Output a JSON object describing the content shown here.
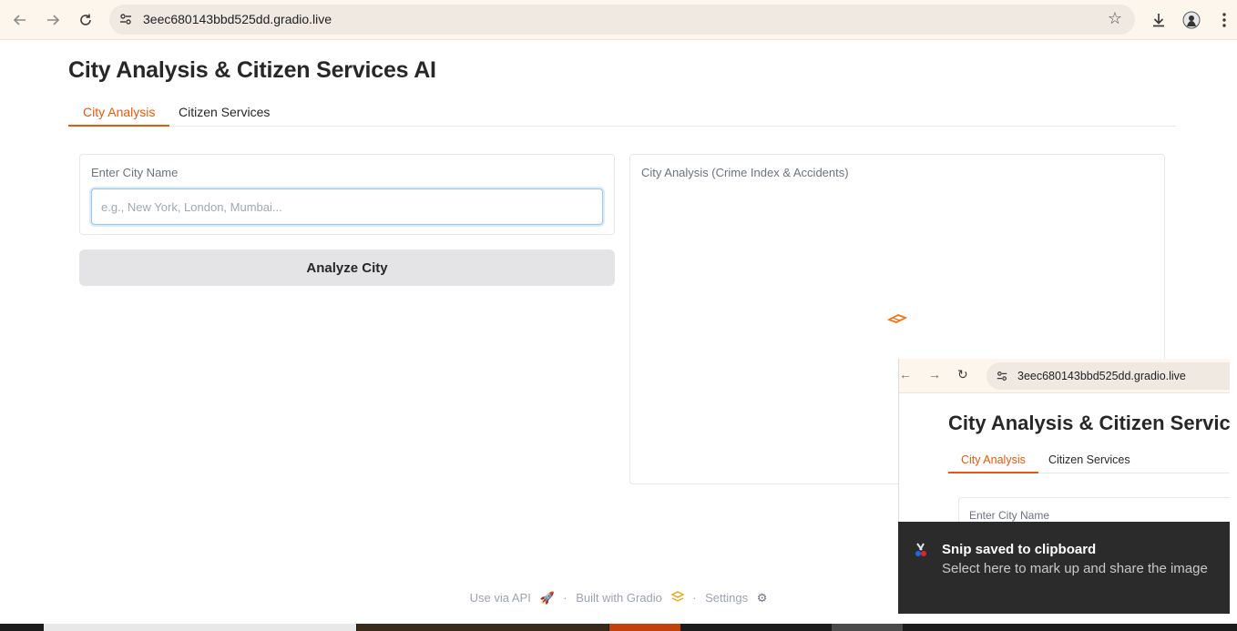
{
  "browser": {
    "url": "3eec680143bbd525dd.gradio.live"
  },
  "app": {
    "title": "City Analysis & Citizen Services AI",
    "tabs": [
      {
        "label": "City Analysis",
        "active": true
      },
      {
        "label": "Citizen Services",
        "active": false
      }
    ],
    "input_panel": {
      "label": "Enter City Name",
      "placeholder": "e.g., New York, London, Mumbai...",
      "value": ""
    },
    "analyze_button": "Analyze City",
    "output_panel": {
      "label": "City Analysis (Crime Index & Accidents)"
    },
    "accent_color": "#ea580c"
  },
  "footer": {
    "api": "Use via API",
    "built": "Built with Gradio",
    "settings": "Settings",
    "separator": "·"
  },
  "snip_preview": {
    "url": "3eec680143bbd525dd.gradio.live",
    "title": "City Analysis & Citizen Services",
    "tabs": [
      "City Analysis",
      "Citizen Services"
    ],
    "panel_label": "Enter City Name"
  },
  "toast": {
    "title": "Snip saved to clipboard",
    "body": "Select here to mark up and share the image"
  }
}
